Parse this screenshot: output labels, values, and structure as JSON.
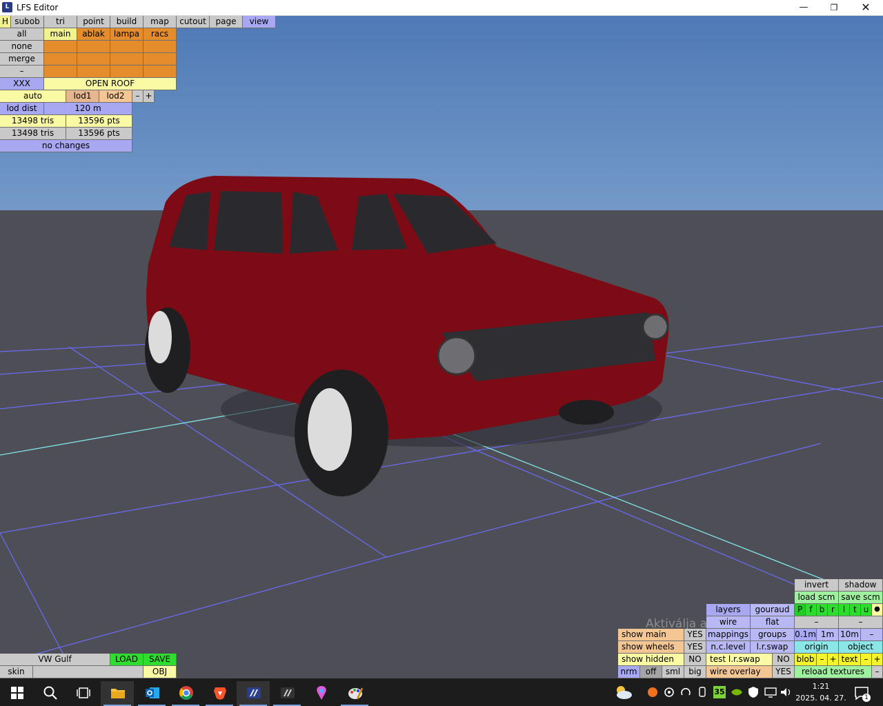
{
  "window": {
    "title": "LFS Editor"
  },
  "menu": {
    "h": "H",
    "tabs": [
      "subob",
      "tri",
      "point",
      "build",
      "map",
      "cutout",
      "page",
      "view"
    ]
  },
  "selection": {
    "all": "all",
    "none": "none",
    "merge": "merge",
    "dash": "–",
    "xxx": "XXX",
    "layers": [
      "main",
      "ablak",
      "lampa",
      "racs"
    ],
    "open_roof": "OPEN ROOF"
  },
  "lod": {
    "auto": "auto",
    "lod1": "lod1",
    "lod2": "lod2",
    "minus": "–",
    "plus": "+",
    "dist_label": "lod dist",
    "dist_value": "120 m",
    "tris1": "13498 tris",
    "pts1": "13596 pts",
    "tris2": "13498 tris",
    "pts2": "13596 pts",
    "changes": "no changes"
  },
  "bottom_left": {
    "name": "VW Gulf",
    "load": "LOAD",
    "save": "SAVE",
    "skin": "skin",
    "obj": "OBJ"
  },
  "right_panel": {
    "invert": "invert",
    "shadow": "shadow",
    "load_scm": "load scm",
    "save_scm": "save scm",
    "layers": "layers",
    "gouraud": "gouraud",
    "wire": "wire",
    "flat": "flat",
    "pfbrltu": [
      "P",
      "f",
      "b",
      "r",
      "l",
      "t",
      "u"
    ],
    "dot": "●",
    "dash": "–",
    "show_main": "show main",
    "show_main_val": "YES",
    "mappings": "mappings",
    "groups": "groups",
    "dist": [
      "0.1m",
      "1m",
      "10m"
    ],
    "dist_dash": "–",
    "show_wheels": "show wheels",
    "show_wheels_val": "YES",
    "nc_level": "n.c.level",
    "lr_swap": "l.r.swap",
    "origin": "origin",
    "object": "object",
    "show_hidden": "show hidden",
    "show_hidden_val": "NO",
    "test_lr_swap": "test l.r.swap",
    "test_lr_swap_val": "NO",
    "blob": "blob",
    "text": "text",
    "minus": "–",
    "plus": "+",
    "views": [
      "nrm",
      "off",
      "sml",
      "big"
    ],
    "wire_overlay": "wire overlay",
    "wire_overlay_val": "YES",
    "reload_textures": "reload textures",
    "end_dash": "–"
  },
  "watermark": "Aktiválja a Windows t",
  "taskbar": {
    "time": "1:21",
    "date": "2025. 04. 27.",
    "badge": "35",
    "notif": "1"
  }
}
